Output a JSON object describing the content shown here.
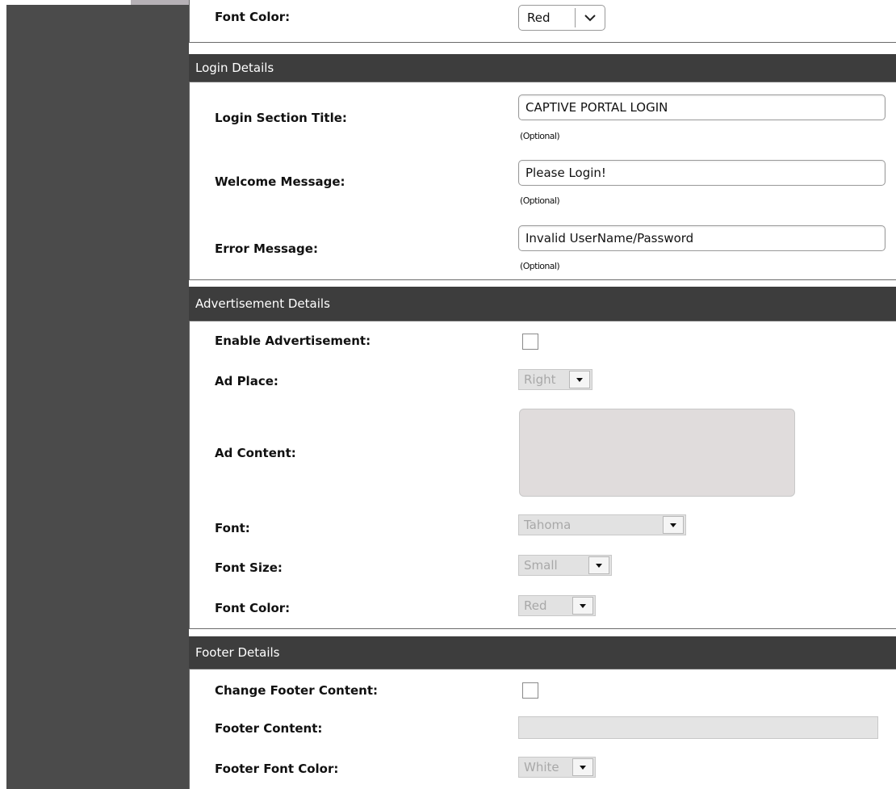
{
  "top_section": {
    "font_color_label": "Font Color:",
    "font_color_value": "Red"
  },
  "login_details": {
    "header": "Login Details",
    "title_label": "Login Section Title:",
    "title_value": "CAPTIVE PORTAL LOGIN",
    "title_hint": "(Optional)",
    "welcome_label": "Welcome Message:",
    "welcome_value": "Please Login!",
    "welcome_hint": "(Optional)",
    "error_label": "Error Message:",
    "error_value": "Invalid UserName/Password",
    "error_hint": "(Optional)"
  },
  "advertisement_details": {
    "header": "Advertisement Details",
    "enable_label": "Enable Advertisement:",
    "enable_checked": false,
    "ad_place_label": "Ad Place:",
    "ad_place_value": "Right",
    "ad_content_label": "Ad Content:",
    "ad_content_value": "",
    "font_label": "Font:",
    "font_value": "Tahoma",
    "font_size_label": "Font Size:",
    "font_size_value": "Small",
    "font_color_label": "Font Color:",
    "font_color_value": "Red"
  },
  "footer_details": {
    "header": "Footer Details",
    "change_label": "Change Footer Content:",
    "change_checked": false,
    "content_label": "Footer Content:",
    "content_value": "",
    "font_color_label": "Footer Font Color:",
    "font_color_value": "White"
  },
  "icons": {
    "dropdown_enabled": "chevron-down-icon",
    "dropdown_disabled": "triangle-down-icon"
  },
  "colors": {
    "sidebar": "#4b4b4b",
    "section_header": "#3d3d3d",
    "disabled_field": "#e2e2e2"
  }
}
